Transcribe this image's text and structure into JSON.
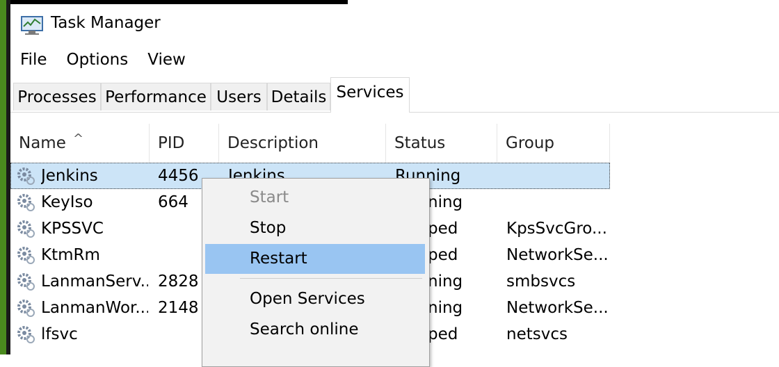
{
  "window": {
    "title": "Task Manager"
  },
  "menu": [
    "File",
    "Options",
    "View"
  ],
  "tabs": [
    "Processes",
    "Performance",
    "Users",
    "Details",
    "Services"
  ],
  "active_tab": "Services",
  "columns": [
    "Name",
    "PID",
    "Description",
    "Status",
    "Group"
  ],
  "rows": [
    {
      "name": "Jenkins",
      "pid": "4456",
      "description": "Jenkins",
      "status": "Running",
      "group": ""
    },
    {
      "name": "KeyIso",
      "pid": "664",
      "description": "",
      "status": "ning",
      "group": ""
    },
    {
      "name": "KPSSVC",
      "pid": "",
      "description": "",
      "status": "ped",
      "group": "KpsSvcGro..."
    },
    {
      "name": "KtmRm",
      "pid": "",
      "description": "",
      "status": "ped",
      "group": "NetworkSe..."
    },
    {
      "name": "LanmanServ...",
      "pid": "2828",
      "description": "",
      "status": "ning",
      "group": "smbsvcs"
    },
    {
      "name": "LanmanWor...",
      "pid": "2148",
      "description": "",
      "status": "ning",
      "group": "NetworkSe..."
    },
    {
      "name": "lfsvc",
      "pid": "",
      "description": "",
      "status": "ped",
      "group": "netsvcs"
    }
  ],
  "context_menu": {
    "start": "Start",
    "stop": "Stop",
    "restart": "Restart",
    "open_services": "Open Services",
    "search_online": "Search online"
  },
  "icons": {
    "app": "task-manager-icon",
    "service": "service-gear-icon",
    "sort": "sort-ascending-icon"
  },
  "colors": {
    "selection": "#cce4f7",
    "menu_highlight": "#99c5f2",
    "menu_bg": "#f2f2f2"
  }
}
